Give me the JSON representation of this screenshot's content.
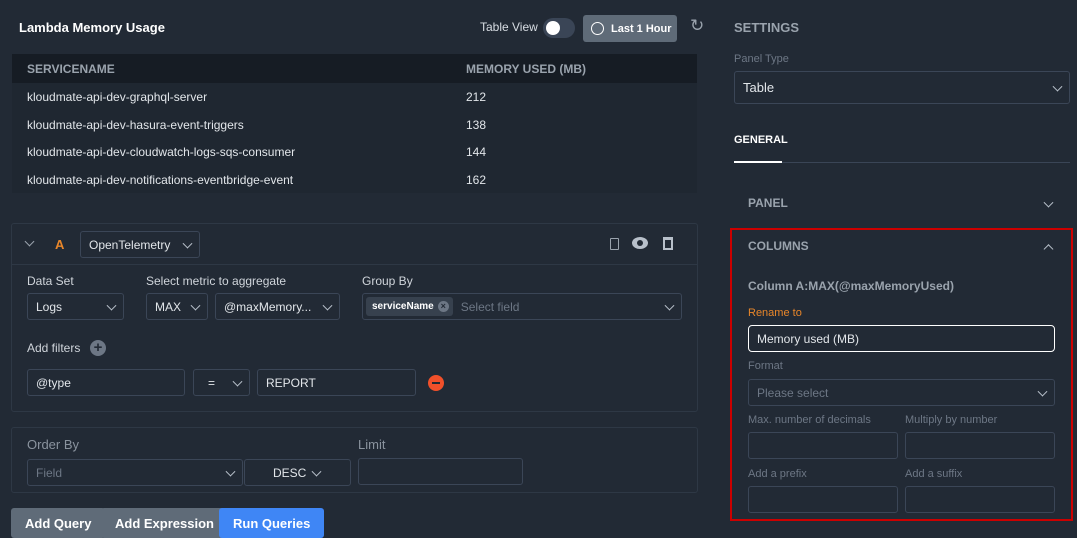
{
  "panel": {
    "title": "Lambda Memory Usage",
    "table_view_label": "Table View",
    "table_view_on": false,
    "time_range": "Last 1 Hour"
  },
  "table": {
    "columns": [
      "SERVICENAME",
      "MEMORY USED (MB)"
    ],
    "rows": [
      [
        "kloudmate-api-dev-graphql-server",
        "212"
      ],
      [
        "kloudmate-api-dev-hasura-event-triggers",
        "138"
      ],
      [
        "kloudmate-api-dev-cloudwatch-logs-sqs-consumer",
        "144"
      ],
      [
        "kloudmate-api-dev-notifications-eventbridge-event",
        "162"
      ]
    ]
  },
  "query": {
    "letter": "A",
    "source": "OpenTelemetry",
    "data_set_label": "Data Set",
    "data_set": "Logs",
    "metric_label": "Select metric to aggregate",
    "agg": "MAX",
    "metric": "@maxMemory...",
    "group_by_label": "Group By",
    "group_tag": "serviceName",
    "group_placeholder": "Select field",
    "add_filters": "Add filters",
    "filter": {
      "field": "@type",
      "op": "=",
      "value": "REPORT"
    }
  },
  "order": {
    "label": "Order By",
    "field_placeholder": "Field",
    "direction": "DESC",
    "limit_label": "Limit"
  },
  "buttons": {
    "add_query": "Add Query",
    "add_expression": "Add Expression",
    "run_queries": "Run Queries"
  },
  "settings": {
    "title": "SETTINGS",
    "panel_type_label": "Panel Type",
    "panel_type": "Table",
    "tab": "GENERAL",
    "panel_section": "PANEL",
    "columns_section": "COLUMNS",
    "column_title": "Column A:MAX(@maxMemoryUsed)",
    "rename_label": "Rename to",
    "rename_value": "Memory used (MB)",
    "format_label": "Format",
    "format_placeholder": "Please select",
    "decimals_label": "Max. number of decimals",
    "multiply_label": "Multiply by number",
    "prefix_label": "Add a prefix",
    "suffix_label": "Add a suffix"
  },
  "colors": {
    "accent_orange": "#e8862a",
    "primary": "#3f86f5",
    "highlight": "#cc0000"
  }
}
